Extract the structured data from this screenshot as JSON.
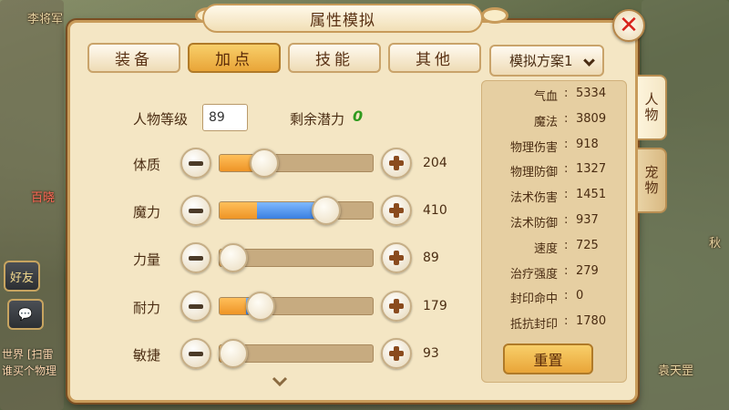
{
  "background": {
    "names": [
      "李将军",
      "百晓",
      "好友",
      "袁天罡",
      "秋"
    ],
    "chat": [
      "世界 [扫雷",
      "谁买个物理"
    ]
  },
  "window": {
    "title": "属性模拟",
    "close_icon": "close-icon"
  },
  "tabs": [
    {
      "label": "装备",
      "active": false
    },
    {
      "label": "加点",
      "active": true
    },
    {
      "label": "技能",
      "active": false
    },
    {
      "label": "其他",
      "active": false
    }
  ],
  "level": {
    "label": "人物等级",
    "value": "89"
  },
  "potential": {
    "label": "剩余潜力",
    "value": "0"
  },
  "stats": [
    {
      "label": "体质",
      "value": "204",
      "base": 0.22,
      "added": 0.06
    },
    {
      "label": "魔力",
      "value": "410",
      "base": 0.24,
      "added": 0.44
    },
    {
      "label": "力量",
      "value": "89",
      "base": 0.08,
      "added": 0.0
    },
    {
      "label": "耐力",
      "value": "179",
      "base": 0.17,
      "added": 0.09
    },
    {
      "label": "敏捷",
      "value": "93",
      "base": 0.08,
      "added": 0.0
    }
  ],
  "plan": {
    "label": "模拟方案1"
  },
  "attributes": [
    {
      "name": "气血",
      "value": "5334"
    },
    {
      "name": "魔法",
      "value": "3809"
    },
    {
      "name": "物理伤害",
      "value": "918"
    },
    {
      "name": "物理防御",
      "value": "1327"
    },
    {
      "name": "法术伤害",
      "value": "1451"
    },
    {
      "name": "法术防御",
      "value": "937"
    },
    {
      "name": "速度",
      "value": "725"
    },
    {
      "name": "治疗强度",
      "value": "279"
    },
    {
      "name": "封印命中",
      "value": "0"
    },
    {
      "name": "抵抗封印",
      "value": "1780"
    }
  ],
  "reset": {
    "label": "重置"
  },
  "side_tabs": [
    {
      "label": "人物",
      "active": true
    },
    {
      "label": "宠物",
      "active": false
    }
  ],
  "colors": {
    "base_fill": "#ee9426",
    "added_fill": "#3a7fe0",
    "potential": "#2f9a1e",
    "close": "#d8231c"
  }
}
